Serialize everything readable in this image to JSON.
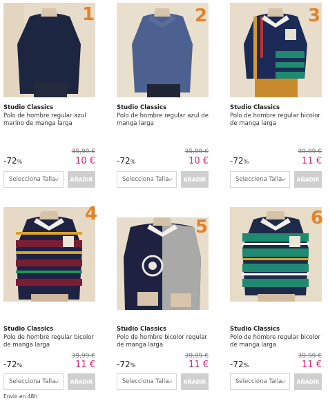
{
  "products": [
    {
      "number": "1",
      "brand": "Studio Classics",
      "title": "Polo de hombre regular azul marino de manga larga",
      "old_price": "35,99 €",
      "discount": "-72",
      "discount_unit": "%",
      "price": "10 €",
      "size_placeholder": "Selecciona Talla",
      "add_label": "AÑADIR"
    },
    {
      "number": "2",
      "brand": "Studio Classics",
      "title": "Polo de hombre regular azul de manga larga",
      "old_price": "35,99 €",
      "discount": "-72",
      "discount_unit": "%",
      "price": "10 €",
      "size_placeholder": "Selecciona Talla",
      "add_label": "AÑADIR"
    },
    {
      "number": "3",
      "brand": "Studio Classics",
      "title": "Polo de hombre regular bicolor de manga larga",
      "old_price": "39,99 €",
      "discount": "-72",
      "discount_unit": "%",
      "price": "11 €",
      "size_placeholder": "Selecciona Talla",
      "add_label": "AÑADIR"
    },
    {
      "number": "4",
      "brand": "Studio Classics",
      "title": "Polo de hombre regular bicolor de manga larga",
      "old_price": "39,99 €",
      "discount": "-72",
      "discount_unit": "%",
      "price": "11 €",
      "size_placeholder": "Selecciona Talla",
      "add_label": "AÑADIR"
    },
    {
      "number": "5",
      "brand": "Studio Classics",
      "title": "Polo de hombre bicolor regular de manga larga",
      "old_price": "39,99 €",
      "discount": "-72",
      "discount_unit": "%",
      "price": "11 €",
      "size_placeholder": "Selecciona Talla",
      "add_label": "AÑADIR"
    },
    {
      "number": "6",
      "brand": "Studio Classics",
      "title": "Polo de hombre regular bicolor de manga larga",
      "old_price": "39,99 €",
      "discount": "-72",
      "discount_unit": "%",
      "price": "11 €",
      "size_placeholder": "Selecciona Talla",
      "add_label": "AÑADIR"
    }
  ],
  "footer": {
    "shipping": "Envío en 48h"
  },
  "colors": {
    "price": "#e0237b",
    "number_badge": "#e0832a",
    "add_button": "#cfcfcf",
    "photo_bg": "#e8ddcb"
  }
}
